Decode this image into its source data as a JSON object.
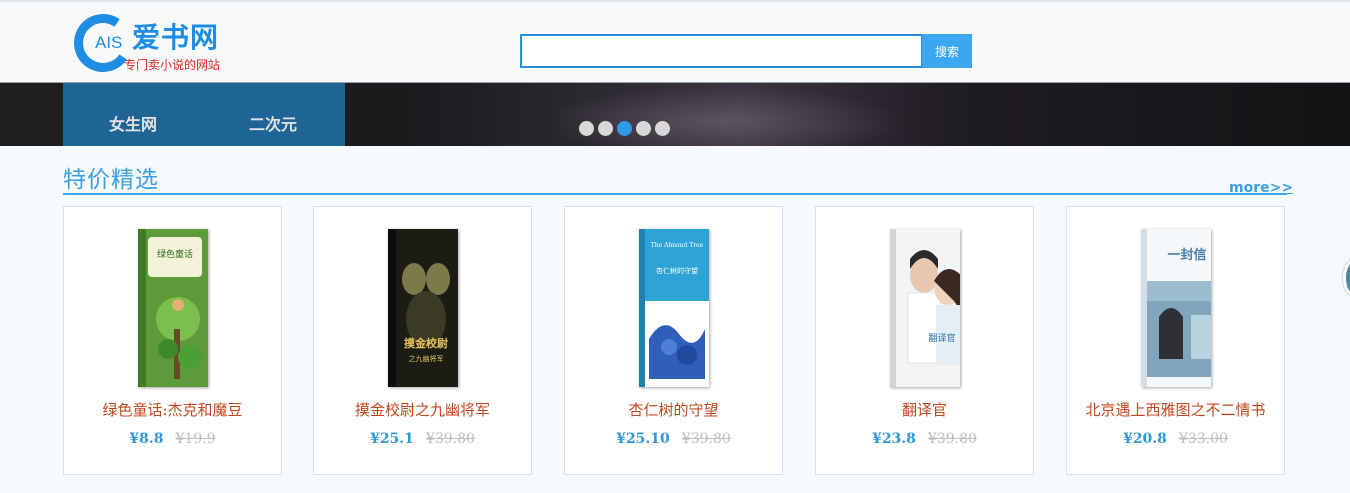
{
  "header": {
    "logo": {
      "ais": "AIS",
      "name": "爱书网",
      "slogan": "专门卖小说的网站"
    },
    "search": {
      "placeholder": "",
      "value": "",
      "button_label": "搜索"
    }
  },
  "banner": {
    "nav_items": [
      {
        "label": "女生网"
      },
      {
        "label": "二次元"
      }
    ],
    "carousel": {
      "slide_count": 5,
      "active_index": 2
    }
  },
  "section": {
    "title": "特价精选",
    "more_label": "more>>",
    "products": [
      {
        "title": "绿色童话:杰克和魔豆",
        "price": "¥8.8",
        "original_price": "¥19.9"
      },
      {
        "title": "摸金校尉之九幽将军",
        "price": "¥25.1",
        "original_price": "¥39.80"
      },
      {
        "title": "杏仁树的守望",
        "price": "¥25.10",
        "original_price": "¥39.80"
      },
      {
        "title": "翻译官",
        "price": "¥23.8",
        "original_price": "¥39.80"
      },
      {
        "title": "北京遇上西雅图之不二情书",
        "price": "¥20.8",
        "original_price": "¥33.00"
      }
    ]
  },
  "colors": {
    "accent": "#3aa7f0",
    "title_red": "#c3461d",
    "nav_bg": "#1f6fa6",
    "dot_active": "#2f9be8"
  }
}
